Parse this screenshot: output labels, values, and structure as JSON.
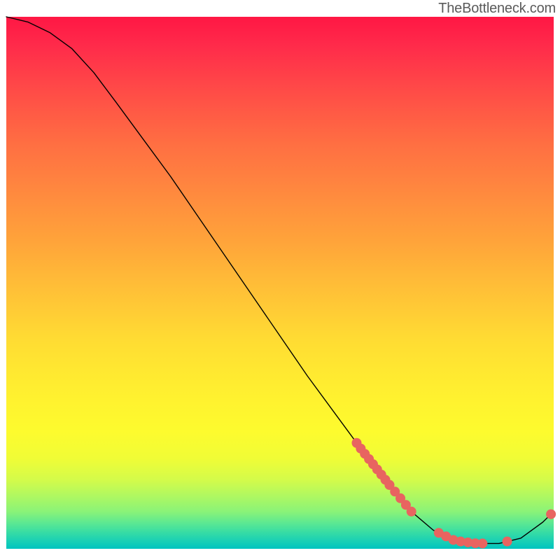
{
  "watermark": "TheBottleneck.com",
  "chart_data": {
    "type": "line",
    "title": "",
    "xlabel": "",
    "ylabel": "",
    "xlim": [
      0,
      100
    ],
    "ylim": [
      0,
      100
    ],
    "note": "No axis ticks or labels are rendered in the source image; values below are estimated from the curve shape and marker positions in normalized 0–100 coordinates.",
    "curve_points": [
      {
        "x": 0,
        "y": 100
      },
      {
        "x": 4,
        "y": 99
      },
      {
        "x": 8,
        "y": 97
      },
      {
        "x": 12,
        "y": 94
      },
      {
        "x": 16,
        "y": 89.5
      },
      {
        "x": 20,
        "y": 84
      },
      {
        "x": 25,
        "y": 77
      },
      {
        "x": 30,
        "y": 70
      },
      {
        "x": 35,
        "y": 62.5
      },
      {
        "x": 40,
        "y": 55
      },
      {
        "x": 45,
        "y": 47.5
      },
      {
        "x": 50,
        "y": 40
      },
      {
        "x": 55,
        "y": 32.5
      },
      {
        "x": 60,
        "y": 25.5
      },
      {
        "x": 65,
        "y": 18.5
      },
      {
        "x": 70,
        "y": 12
      },
      {
        "x": 74,
        "y": 7
      },
      {
        "x": 78,
        "y": 3.5
      },
      {
        "x": 82,
        "y": 1.5
      },
      {
        "x": 86,
        "y": 1
      },
      {
        "x": 90,
        "y": 1
      },
      {
        "x": 94,
        "y": 2
      },
      {
        "x": 98,
        "y": 5
      },
      {
        "x": 100,
        "y": 7
      }
    ],
    "marker_clusters": [
      {
        "approx_x_range": [
          64,
          70
        ],
        "approx_y_range": [
          12,
          21
        ],
        "count": 9,
        "description": "dense cluster on descending slope"
      },
      {
        "approx_x_range": [
          70,
          74
        ],
        "approx_y_range": [
          7,
          12
        ],
        "count": 5,
        "description": "second cluster on lower slope"
      },
      {
        "approx_x_range": [
          79,
          87
        ],
        "approx_y_range": [
          1,
          2
        ],
        "count": 7,
        "description": "cluster along flat minimum"
      },
      {
        "approx_x_range": [
          91,
          92
        ],
        "approx_y_range": [
          1,
          2
        ],
        "count": 1,
        "description": "single marker near minimum"
      },
      {
        "approx_x_range": [
          99,
          100
        ],
        "approx_y_range": [
          6,
          8
        ],
        "count": 1,
        "description": "single marker on rising tail"
      }
    ],
    "marker_style": {
      "shape": "circle",
      "color": "#e86460",
      "radius_px": 7
    }
  }
}
